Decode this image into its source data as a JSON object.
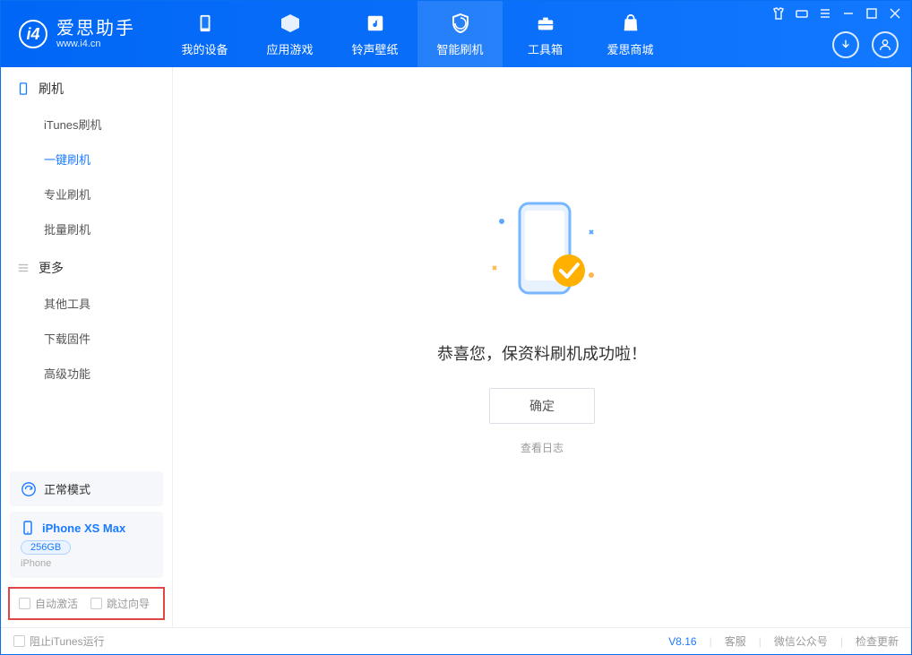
{
  "app": {
    "title": "爱思助手",
    "subtitle": "www.i4.cn"
  },
  "nav": [
    {
      "label": "我的设备",
      "icon": "phone"
    },
    {
      "label": "应用游戏",
      "icon": "cube"
    },
    {
      "label": "铃声壁纸",
      "icon": "music"
    },
    {
      "label": "智能刷机",
      "icon": "shield",
      "active": true
    },
    {
      "label": "工具箱",
      "icon": "toolbox"
    },
    {
      "label": "爱思商城",
      "icon": "bag"
    }
  ],
  "sidebar": {
    "group1": {
      "title": "刷机",
      "items": [
        "iTunes刷机",
        "一键刷机",
        "专业刷机",
        "批量刷机"
      ],
      "activeIndex": 1
    },
    "group2": {
      "title": "更多",
      "items": [
        "其他工具",
        "下载固件",
        "高级功能"
      ]
    },
    "status": "正常模式",
    "device": {
      "name": "iPhone XS Max",
      "storage": "256GB",
      "type": "iPhone"
    },
    "checks": {
      "autoActivate": "自动激活",
      "skipGuide": "跳过向导"
    }
  },
  "main": {
    "successTitle": "恭喜您，保资料刷机成功啦！",
    "confirmBtn": "确定",
    "logLink": "查看日志"
  },
  "footer": {
    "blockItunes": "阻止iTunes运行",
    "version": "V8.16",
    "links": [
      "客服",
      "微信公众号",
      "检查更新"
    ]
  }
}
